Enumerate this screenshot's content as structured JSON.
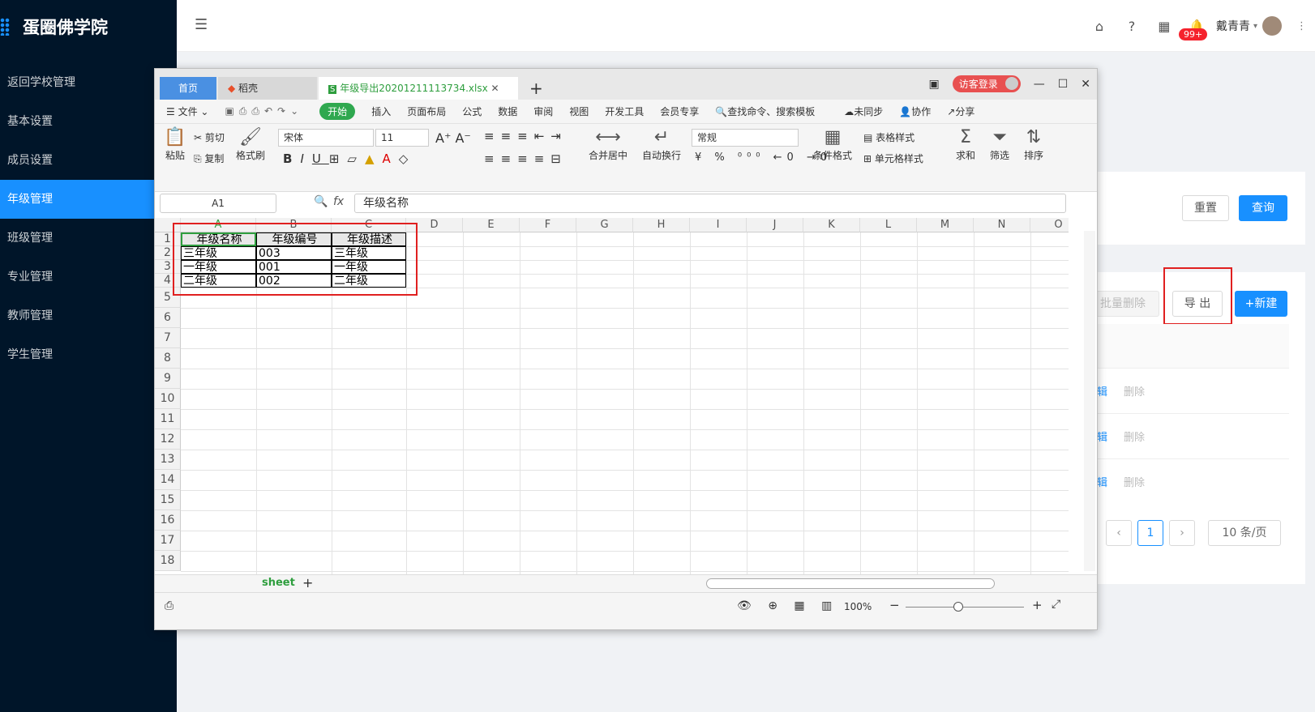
{
  "app": {
    "name": "蛋圈佛学院"
  },
  "sidebar": {
    "items": [
      {
        "label": "返回学校管理"
      },
      {
        "label": "基本设置"
      },
      {
        "label": "成员设置"
      },
      {
        "label": "年级管理"
      },
      {
        "label": "班级管理"
      },
      {
        "label": "专业管理"
      },
      {
        "label": "教师管理"
      },
      {
        "label": "学生管理"
      }
    ],
    "active": "年级管理"
  },
  "header": {
    "badge": "99+",
    "user": "戴青青"
  },
  "page": {
    "reset_label": "重置",
    "query_label": "查询",
    "batch_delete_label": "批量删除",
    "export_label": "导 出",
    "new_label": "+新建",
    "rows": [
      {
        "edit": "编辑",
        "delete": "删除"
      },
      {
        "edit": "编辑",
        "delete": "删除"
      },
      {
        "edit": "编辑",
        "delete": "删除"
      }
    ],
    "pagination": {
      "current": "1",
      "page_size": "10 条/页"
    }
  },
  "wps": {
    "tabs": {
      "home": "首页",
      "doc": "稻壳",
      "file": "年级导出20201211113734.xlsx"
    },
    "visitor": "访客登录",
    "menu": [
      "文件",
      "开始",
      "插入",
      "页面布局",
      "公式",
      "数据",
      "审阅",
      "视图",
      "开发工具",
      "会员专享"
    ],
    "search": "查找命令、搜索模板",
    "sync": "未同步",
    "collab": "协作",
    "share": "分享",
    "ribbon": {
      "paste": "粘贴",
      "cut": "剪切",
      "copy": "复制",
      "format_painter": "格式刷",
      "font": "宋体",
      "size": "11",
      "merge": "合并居中",
      "wrap": "自动换行",
      "number_format": "常规",
      "cond_format": "条件格式",
      "table_style": "表格样式",
      "cell_style": "单元格样式",
      "sum": "求和",
      "filter": "筛选",
      "sort": "排序"
    },
    "namebox": "A1",
    "fx": "fx",
    "formula": "年级名称",
    "columns": [
      "A",
      "B",
      "C",
      "D",
      "E",
      "F",
      "G",
      "H",
      "I",
      "J",
      "K",
      "L",
      "M",
      "N",
      "O"
    ],
    "rows": [
      "1",
      "2",
      "3",
      "4",
      "5",
      "6",
      "7",
      "8",
      "9",
      "10",
      "11",
      "12",
      "13",
      "14",
      "15",
      "16",
      "17",
      "18"
    ],
    "cells": [
      [
        "年级名称",
        "年级编号",
        "年级描述"
      ],
      [
        "三年级",
        "003",
        "三年级"
      ],
      [
        "一年级",
        "001",
        "一年级"
      ],
      [
        "二年级",
        "002",
        "二年级"
      ]
    ],
    "sheet": "sheet",
    "zoom": "100%"
  }
}
